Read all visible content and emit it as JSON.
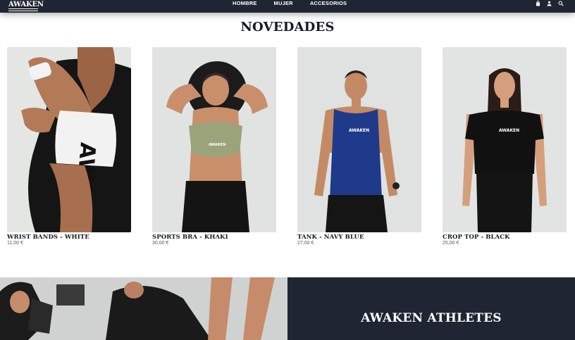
{
  "header": {
    "logo_text": "AWAKEN",
    "nav": [
      "HOMBRE",
      "MUJER",
      "ACCESORIOS"
    ],
    "icons": [
      "bag-icon",
      "user-icon",
      "search-icon"
    ]
  },
  "section": {
    "title": "NOVEDADES"
  },
  "products": [
    {
      "name": "WRIST BANDS - WHITE",
      "price": "11,00 €",
      "print_text": "AWAKEN"
    },
    {
      "name": "SPORTS BRA - KHAKI",
      "price": "30,00 €",
      "print_text": "AWAKEN"
    },
    {
      "name": "TANK - NAVY BLUE",
      "price": "27,00 €",
      "print_text": "AWAKEN"
    },
    {
      "name": "CROP TOP - BLACK",
      "price": "25,00 €",
      "print_text": "AWAKEN"
    }
  ],
  "banner": {
    "title": "AWAKEN ATHLETES"
  },
  "colors": {
    "header_bg": "#1f2532",
    "banner_bg": "#1f2532",
    "photo_bg": "#dfe2e0",
    "text": "#141a26"
  }
}
